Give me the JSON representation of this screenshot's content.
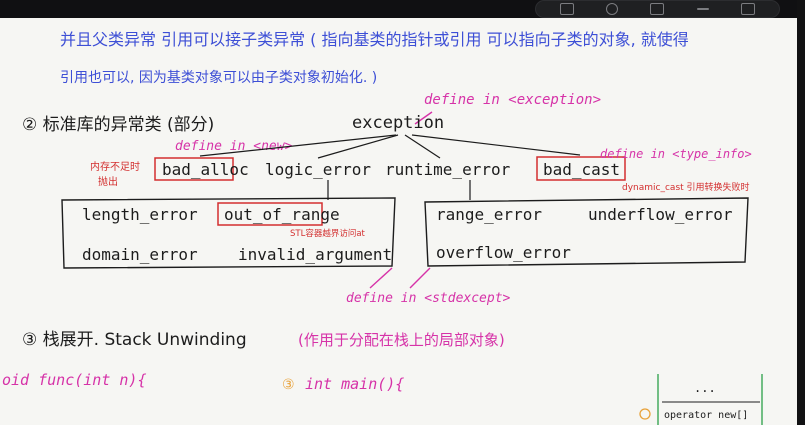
{
  "notes": {
    "line1": "并且父类异常 引用可以接子类异常 ( 指向基类的指针或引用 可以指向子类的对象, 就使得",
    "line2": "引用也可以, 因为基类对象可以由子类对象初始化. )",
    "define_exception": "define in <exception>",
    "section2_title": "② 标准库的异常类 (部分)",
    "exception": "exception",
    "define_new": "define in <new>",
    "bad_alloc": "bad_alloc",
    "bad_alloc_note1": "内存不足时",
    "bad_alloc_note2": "抛出",
    "logic_error": "logic_error",
    "runtime_error": "runtime_error",
    "bad_cast": "bad_cast",
    "define_typeinfo": "define in <type_info>",
    "dynamic_cast_note": "dynamic_cast 引用转换失败时",
    "length_error": "length_error",
    "out_of_range": "out_of_range",
    "stl_note": "STL容器越界访问at",
    "range_error": "range_error",
    "underflow_error": "underflow_error",
    "domain_error": "domain_error",
    "invalid_argument": "invalid_argument",
    "overflow_error": "overflow_error",
    "define_stdexcept": "define in <stdexcept>",
    "section3_title": "③ 栈展开. Stack Unwinding",
    "section3_note": "(作用于分配在栈上的局部对象)",
    "code_left": "oid func(int n){",
    "marker3": "③",
    "code_main": "int main(){",
    "dots": "...",
    "operator_new": "operator new[]"
  },
  "colors": {
    "ink": "#1c1c1c",
    "blue": "#3d4fd6",
    "magenta": "#d633a8",
    "red": "#d32f2f",
    "orange": "#e8a23a",
    "green": "#3aa655"
  }
}
